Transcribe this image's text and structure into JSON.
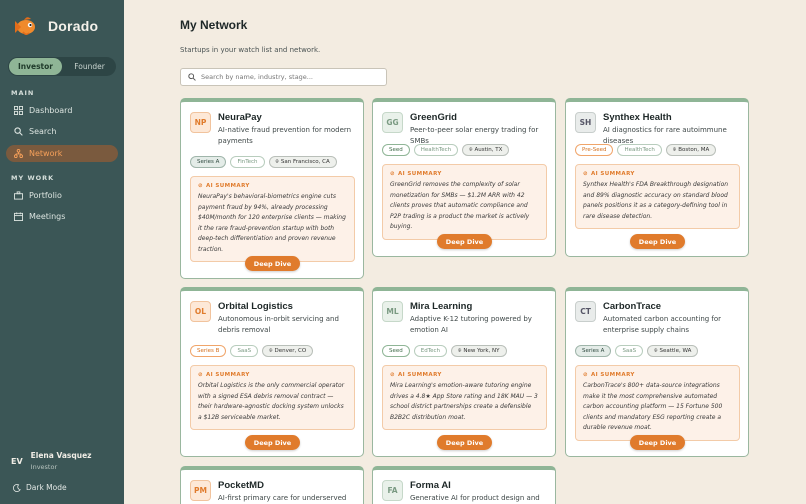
{
  "app": {
    "name": "Dorado"
  },
  "toggle": {
    "investor": "Investor",
    "founder": "Founder"
  },
  "nav": {
    "main_label": "MAIN",
    "dashboard": "Dashboard",
    "search": "Search",
    "network": "Network",
    "mywork_label": "MY WORK",
    "portfolio": "Portfolio",
    "meetings": "Meetings"
  },
  "user": {
    "initials": "EV",
    "name": "Elena Vasquez",
    "role": "Investor"
  },
  "darkmode": "Dark Mode",
  "page": {
    "title": "My Network",
    "subtitle": "Startups in your watch list and network.",
    "search_placeholder": "Search by name, industry, stage..."
  },
  "ai_label": "AI SUMMARY",
  "deep_dive": "Deep Dive",
  "cards": [
    {
      "initials": "NP",
      "name": "NeuraPay",
      "desc": "AI-native fraud prevention for modern payments",
      "stage": "Series A",
      "industry": "FinTech",
      "location": "San Francisco, CA",
      "summary": "NeuraPay's behavioral-biometrics engine cuts payment fraud by 94%, already processing $40M/month for 120 enterprise clients — making it the rare fraud-prevention startup with both deep-tech differentiation and proven revenue traction."
    },
    {
      "initials": "GG",
      "name": "GreenGrid",
      "desc": "Peer-to-peer solar energy trading for SMBs",
      "stage": "Seed",
      "industry": "HealthTech",
      "location": "Austin, TX",
      "summary": "GreenGrid removes the complexity of solar monetization for SMBs — $1.2M ARR with 42 clients proves that automatic compliance and P2P trading is a product the market is actively buying."
    },
    {
      "initials": "SH",
      "name": "Synthex Health",
      "desc": "AI diagnostics for rare autoimmune diseases",
      "stage": "Pre-Seed",
      "industry": "HealthTech",
      "location": "Boston, MA",
      "summary": "Synthex Health's FDA Breakthrough designation and 89% diagnostic accuracy on standard blood panels positions it as a category-defining tool in rare disease detection."
    },
    {
      "initials": "OL",
      "name": "Orbital Logistics",
      "desc": "Autonomous in-orbit servicing and debris removal",
      "stage": "Series B",
      "industry": "SaaS",
      "location": "Denver, CO",
      "summary": "Orbital Logistics is the only commercial operator with a signed ESA debris removal contract — their hardware-agnostic docking system unlocks a $12B serviceable market."
    },
    {
      "initials": "ML",
      "name": "Mira Learning",
      "desc": "Adaptive K-12 tutoring powered by emotion AI",
      "stage": "Seed",
      "industry": "EdTech",
      "location": "New York, NY",
      "summary": "Mira Learning's emotion-aware tutoring engine drives a 4.8★ App Store rating and 18K MAU — 3 school district partnerships create a defensible B2B2C distribution moat."
    },
    {
      "initials": "CT",
      "name": "CarbonTrace",
      "desc": "Automated carbon accounting for enterprise supply chains",
      "stage": "Series A",
      "industry": "SaaS",
      "location": "Seattle, WA",
      "summary": "CarbonTrace's 800+ data-source integrations make it the most comprehensive automated carbon accounting platform — 15 Fortune 500 clients and mandatory ESG reporting create a durable revenue moat."
    },
    {
      "initials": "PM",
      "name": "PocketMD",
      "desc": "AI-first primary care for underserved"
    },
    {
      "initials": "FA",
      "name": "Forma AI",
      "desc": "Generative AI for product design and"
    }
  ],
  "colors": {
    "sidebar": "#3b5656",
    "accent": "#e07b2c",
    "card_border": "#8fb596",
    "background": "#f3ece1"
  }
}
